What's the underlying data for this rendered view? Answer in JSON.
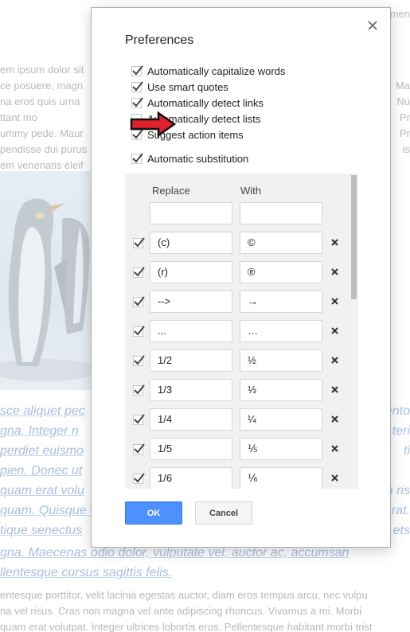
{
  "background_doc": {
    "top_right": "men",
    "lines_gray_top": [
      "em ipsum dolor sit",
      "ce posuere, magn",
      "na eros quis urna",
      "ttant mo",
      "ummy pede. Maur",
      "pendisse dui purus",
      "em venenatis eleif"
    ],
    "lines_gray_top_right": [
      "Ma",
      "Nu",
      "Pr",
      "Pr",
      "is"
    ],
    "lines_blue": [
      "sce aliquet pec",
      "gna. Integer n",
      "perdiet euismo",
      "pien. Donec ut",
      "quam erat volu",
      "quam. Quisque e",
      "tique senectus",
      "gna. Maecenas odio dolor, vulputate vel, auctor ac, accumsan",
      "llentesque cursus sagittis felis."
    ],
    "lines_blue_right": [
      "ento",
      "teri",
      "ti",
      "m ris",
      "rat.",
      "ets",
      ""
    ],
    "lines_gray_bottom": [
      "entesque porttitor, velit lacinia egestas auctor, diam eros tempus arcu, nec vulpu",
      "na vel risus. Cras non magna vel ante adipiscing rhoncus. Vivamus a mi. Morbi",
      "quam erat volutpat. Integer ultrices lobortis eros. Pellentesque habitant morbi trist"
    ]
  },
  "dialog": {
    "title": "Preferences",
    "options": [
      {
        "label": "Automatically capitalize words",
        "checked": true
      },
      {
        "label": "Use smart quotes",
        "checked": true
      },
      {
        "label": "Automatically detect links",
        "checked": true
      },
      {
        "label": "Automatically detect lists",
        "checked": false
      },
      {
        "label": "Suggest action items",
        "checked": true
      }
    ],
    "auto_substitution": {
      "label": "Automatic substitution",
      "checked": true
    },
    "table": {
      "col_replace": "Replace",
      "col_with": "With",
      "new_replace": "",
      "new_with": "",
      "rows": [
        {
          "replace": "(c)",
          "with": "©"
        },
        {
          "replace": "(r)",
          "with": "®"
        },
        {
          "replace": "-->",
          "with": "→"
        },
        {
          "replace": "...",
          "with": "…"
        },
        {
          "replace": "1/2",
          "with": "½"
        },
        {
          "replace": "1/3",
          "with": "⅓"
        },
        {
          "replace": "1/4",
          "with": "¼"
        },
        {
          "replace": "1/5",
          "with": "⅕"
        },
        {
          "replace": "1/6",
          "with": "⅙"
        }
      ]
    },
    "ok_label": "OK",
    "cancel_label": "Cancel"
  },
  "colors": {
    "primary_button": "#4d90fe",
    "annotation_arrow": "#e0202a",
    "doc_link_text": "#a9bedf"
  }
}
